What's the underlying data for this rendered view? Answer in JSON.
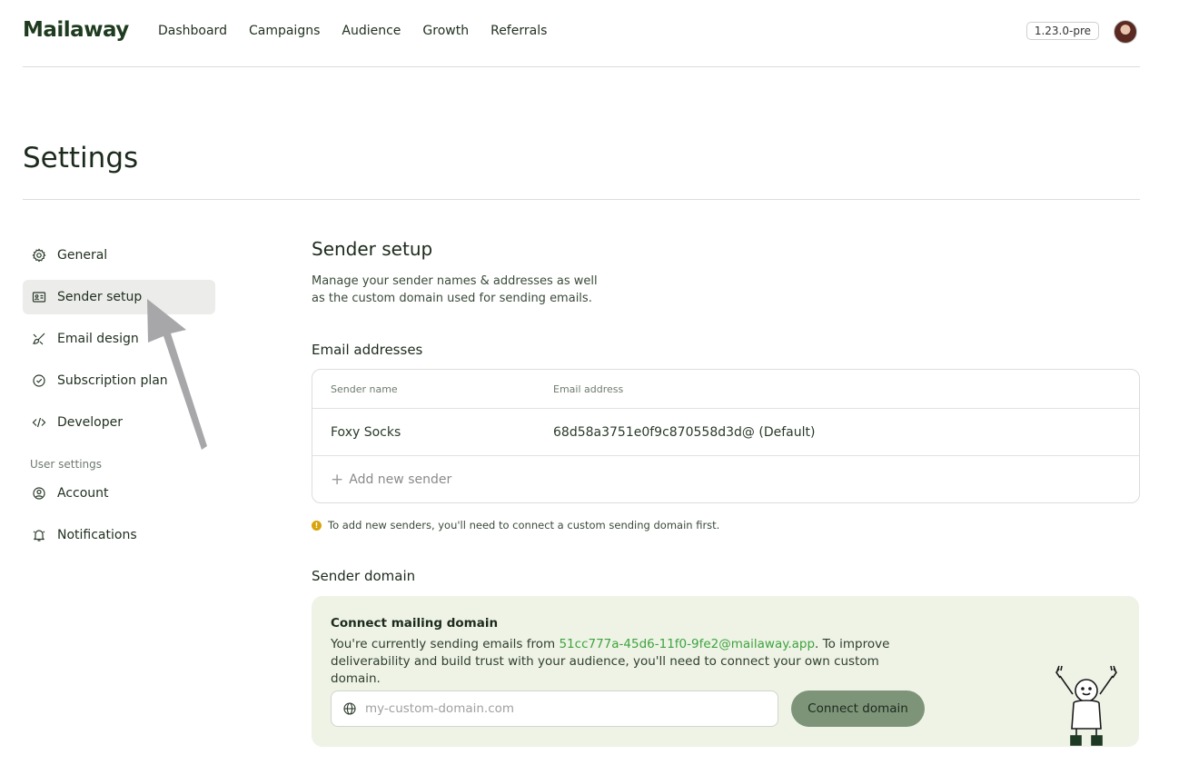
{
  "header": {
    "logo": "Mailaway",
    "nav": [
      "Dashboard",
      "Campaigns",
      "Audience",
      "Growth",
      "Referrals"
    ],
    "version": "1.23.0-pre"
  },
  "page": {
    "title": "Settings"
  },
  "sidebar": {
    "items": [
      {
        "label": "General",
        "icon": "gear-icon"
      },
      {
        "label": "Sender setup",
        "icon": "id-card-icon",
        "active": true
      },
      {
        "label": "Email design",
        "icon": "brush-icon"
      },
      {
        "label": "Subscription plan",
        "icon": "badge-check-icon"
      },
      {
        "label": "Developer",
        "icon": "code-icon"
      }
    ],
    "user_section_label": "User settings",
    "user_items": [
      {
        "label": "Account",
        "icon": "user-circle-icon"
      },
      {
        "label": "Notifications",
        "icon": "bell-icon"
      }
    ]
  },
  "main": {
    "title": "Sender setup",
    "description": "Manage your sender names & addresses as well as the custom domain used for sending emails.",
    "email_section": {
      "title": "Email addresses",
      "columns": [
        "Sender name",
        "Email address"
      ],
      "rows": [
        {
          "name": "Foxy Socks",
          "email": "68d58a3751e0f9c870558d3d@ (Default)"
        }
      ],
      "add_label": "Add new sender",
      "notice": "To add new senders, you'll need to connect a custom sending domain first."
    },
    "domain_section": {
      "title": "Sender domain",
      "card_title": "Connect mailing domain",
      "text_before": "You're currently sending emails from ",
      "current_address": "51cc777a-45d6-11f0-9fe2@mailaway.app",
      "text_after": ". To improve deliverability and build trust with your audience, you'll need to connect your own custom domain.",
      "input_placeholder": "my-custom-domain.com",
      "button_label": "Connect domain"
    }
  },
  "colors": {
    "accent_green": "#3fa33f",
    "card_bg": "#eef3e6",
    "button_bg": "#7d9478",
    "active_bg": "#ececea",
    "warning": "#d9a40b"
  }
}
